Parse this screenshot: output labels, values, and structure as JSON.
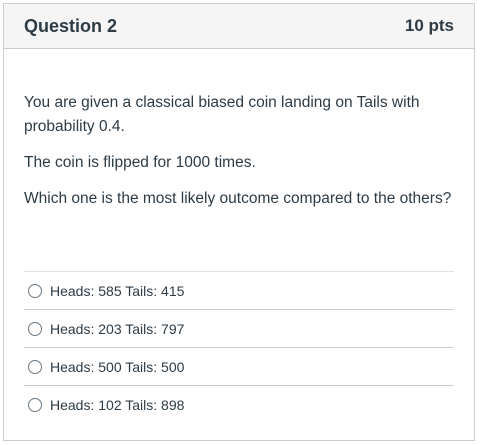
{
  "question": {
    "title": "Question 2",
    "points": "10 pts",
    "paragraphs": [
      "You are given a classical biased coin landing on Tails with probability 0.4.",
      "The coin is flipped for 1000 times.",
      "Which one is the most likely outcome compared to the others?"
    ],
    "answers": [
      "Heads: 585 Tails: 415",
      "Heads: 203 Tails: 797",
      "Heads: 500 Tails: 500",
      "Heads: 102 Tails: 898"
    ]
  }
}
